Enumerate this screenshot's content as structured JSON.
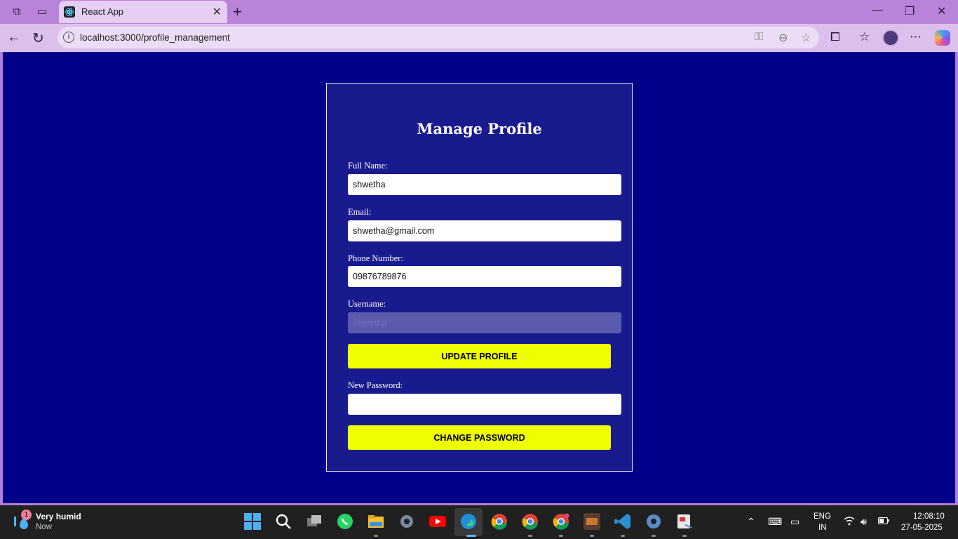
{
  "browser": {
    "tab_title": "React App",
    "url": "localhost:3000/profile_management"
  },
  "page": {
    "heading": "Manage Profile",
    "full_name_label": "Full Name:",
    "full_name_value": "shwetha",
    "email_label": "Email:",
    "email_value": "shwetha@gmail.com",
    "phone_label": "Phone Number:",
    "phone_value": "09876789876",
    "username_label": "Username:",
    "username_value": "Shwetha",
    "update_button": "UPDATE PROFILE",
    "new_password_label": "New Password:",
    "new_password_value": "",
    "change_password_button": "CHANGE PASSWORD"
  },
  "taskbar": {
    "weather_title": "Very humid",
    "weather_sub": "Now",
    "weather_badge": "1",
    "lang_top": "ENG",
    "lang_bottom": "IN",
    "time": "12:08:10",
    "date": "27-05-2025"
  },
  "colors": {
    "page_bg": "#00008b",
    "card_bg": "#1a1a8f",
    "button_bg": "#eeff00",
    "browser_chrome": "#b983da"
  }
}
